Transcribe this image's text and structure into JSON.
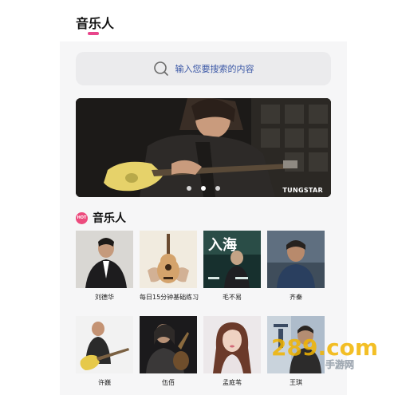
{
  "header": {
    "title": "音乐人"
  },
  "search": {
    "placeholder": "输入您要搜索的内容",
    "icon": "search-icon"
  },
  "banner": {
    "brand": "TUNGSTAR",
    "dots": 3,
    "active_dot": 1
  },
  "section": {
    "title": "音乐人",
    "badge": "HOT"
  },
  "artists": [
    {
      "name": "刘德华",
      "thumb_text": ""
    },
    {
      "name": "每日15分钟基础练习",
      "thumb_text": ""
    },
    {
      "name": "毛不易",
      "thumb_text": "入海"
    },
    {
      "name": "齐秦",
      "thumb_text": ""
    },
    {
      "name": "许巍",
      "thumb_text": ""
    },
    {
      "name": "伍佰",
      "thumb_text": ""
    },
    {
      "name": "孟庭苇",
      "thumb_text": ""
    },
    {
      "name": "王琪",
      "thumb_text": ""
    }
  ],
  "watermark": {
    "text": "289.com",
    "sub": "手游网"
  },
  "colors": {
    "accent": "#e8458b",
    "search_text": "#3a57a6",
    "hot": "#ec4b7d"
  }
}
